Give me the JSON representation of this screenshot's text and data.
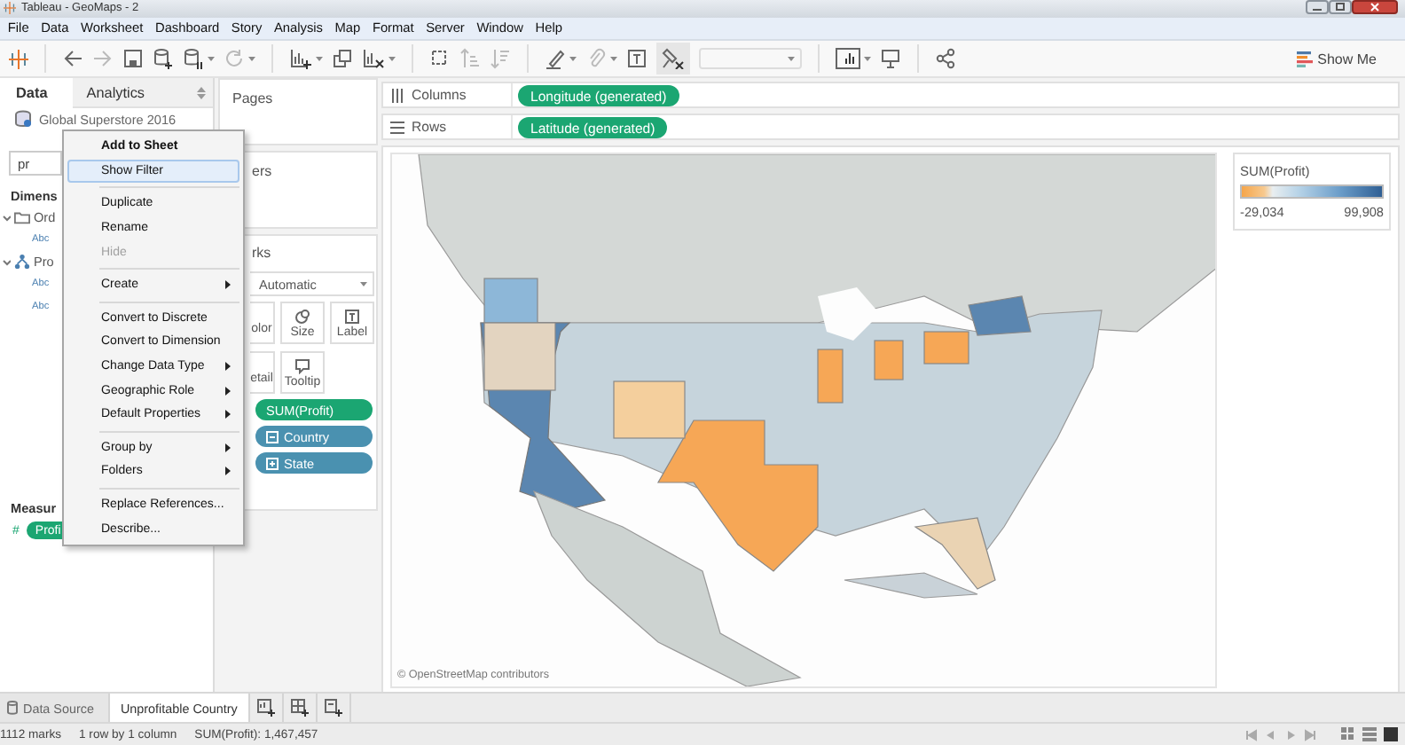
{
  "window": {
    "title": "Tableau - GeoMaps - 2"
  },
  "menu_bar": [
    "File",
    "Data",
    "Worksheet",
    "Dashboard",
    "Story",
    "Analysis",
    "Map",
    "Format",
    "Server",
    "Window",
    "Help"
  ],
  "toolbar": {
    "show_me": "Show Me"
  },
  "data_pane": {
    "tabs": [
      {
        "label": "Data",
        "selected": true
      },
      {
        "label": "Analytics",
        "selected": false
      }
    ],
    "data_source": "Global Superstore 2016",
    "search": {
      "value": "pr"
    },
    "dimensions_heading": "Dimens",
    "tree": [
      {
        "label": "Ord",
        "kind": "folder",
        "expanded": true,
        "children": [
          {
            "type_badge": "Abc"
          }
        ]
      },
      {
        "label": "Pro",
        "kind": "hierarchy",
        "expanded": true,
        "children": [
          {
            "type_badge": "Abc"
          },
          {
            "type_badge": "Abc"
          }
        ]
      }
    ],
    "measures_heading": "Measur",
    "measures": [
      {
        "type_icon": "#",
        "label": "Profi"
      }
    ]
  },
  "cards": {
    "pages": "Pages",
    "filters": "ers",
    "marks": {
      "title": "rks",
      "mark_type": "Automatic",
      "buttons": [
        {
          "label": "olor",
          "kind": "color"
        },
        {
          "label": "Size",
          "kind": "size"
        },
        {
          "label": "Label",
          "kind": "label"
        },
        {
          "label": "etail",
          "kind": "detail"
        },
        {
          "label": "Tooltip",
          "kind": "tooltip"
        }
      ],
      "pills": [
        {
          "label": "SUM(Profit)",
          "kind": "measure"
        },
        {
          "label": "Country",
          "kind": "dimension",
          "expanded": true
        },
        {
          "label": "State",
          "kind": "dimension",
          "expanded": false
        }
      ]
    }
  },
  "shelves": [
    {
      "label": "Columns",
      "kind": "columns",
      "pills": [
        "Longitude (generated)"
      ]
    },
    {
      "label": "Rows",
      "kind": "rows",
      "pills": [
        "Latitude (generated)"
      ]
    }
  ],
  "view": {
    "attribution": "© OpenStreetMap contributors",
    "legend": {
      "title": "SUM(Profit)",
      "min": "-29,034",
      "max": "99,908"
    }
  },
  "context_menu": {
    "groups": [
      {
        "items": [
          {
            "label": "Add to Sheet",
            "default": true,
            "selected": false,
            "disabled": false,
            "submenu": false
          },
          {
            "label": "Show Filter",
            "default": false,
            "selected": true,
            "disabled": false,
            "submenu": false
          }
        ]
      },
      {
        "items": [
          {
            "label": "Duplicate",
            "default": false,
            "selected": false,
            "disabled": false,
            "submenu": false
          },
          {
            "label": "Rename",
            "default": false,
            "selected": false,
            "disabled": false,
            "submenu": false
          },
          {
            "label": "Hide",
            "default": false,
            "selected": false,
            "disabled": true,
            "submenu": false
          }
        ]
      },
      {
        "items": [
          {
            "label": "Create",
            "default": false,
            "selected": false,
            "disabled": false,
            "submenu": true
          }
        ]
      },
      {
        "items": [
          {
            "label": "Convert to Discrete",
            "default": false,
            "selected": false,
            "disabled": false,
            "submenu": false
          },
          {
            "label": "Convert to Dimension",
            "default": false,
            "selected": false,
            "disabled": false,
            "submenu": false
          },
          {
            "label": "Change Data Type",
            "default": false,
            "selected": false,
            "disabled": false,
            "submenu": true
          },
          {
            "label": "Geographic Role",
            "default": false,
            "selected": false,
            "disabled": false,
            "submenu": true
          },
          {
            "label": "Default Properties",
            "default": false,
            "selected": false,
            "disabled": false,
            "submenu": true
          }
        ]
      },
      {
        "items": [
          {
            "label": "Group by",
            "default": false,
            "selected": false,
            "disabled": false,
            "submenu": true
          },
          {
            "label": "Folders",
            "default": false,
            "selected": false,
            "disabled": false,
            "submenu": true
          }
        ]
      },
      {
        "items": [
          {
            "label": "Replace References...",
            "default": false,
            "selected": false,
            "disabled": false,
            "submenu": false
          },
          {
            "label": "Describe...",
            "default": false,
            "selected": false,
            "disabled": false,
            "submenu": false
          }
        ]
      }
    ]
  },
  "sheet_tabs": [
    {
      "label": "Data Source",
      "kind": "data_source",
      "selected": false
    },
    {
      "label": "Unprofitable Country",
      "kind": "sheet",
      "selected": true
    }
  ],
  "status_bar": [
    "1112 marks",
    "1 row by 1 column",
    "SUM(Profit): 1,467,457"
  ]
}
